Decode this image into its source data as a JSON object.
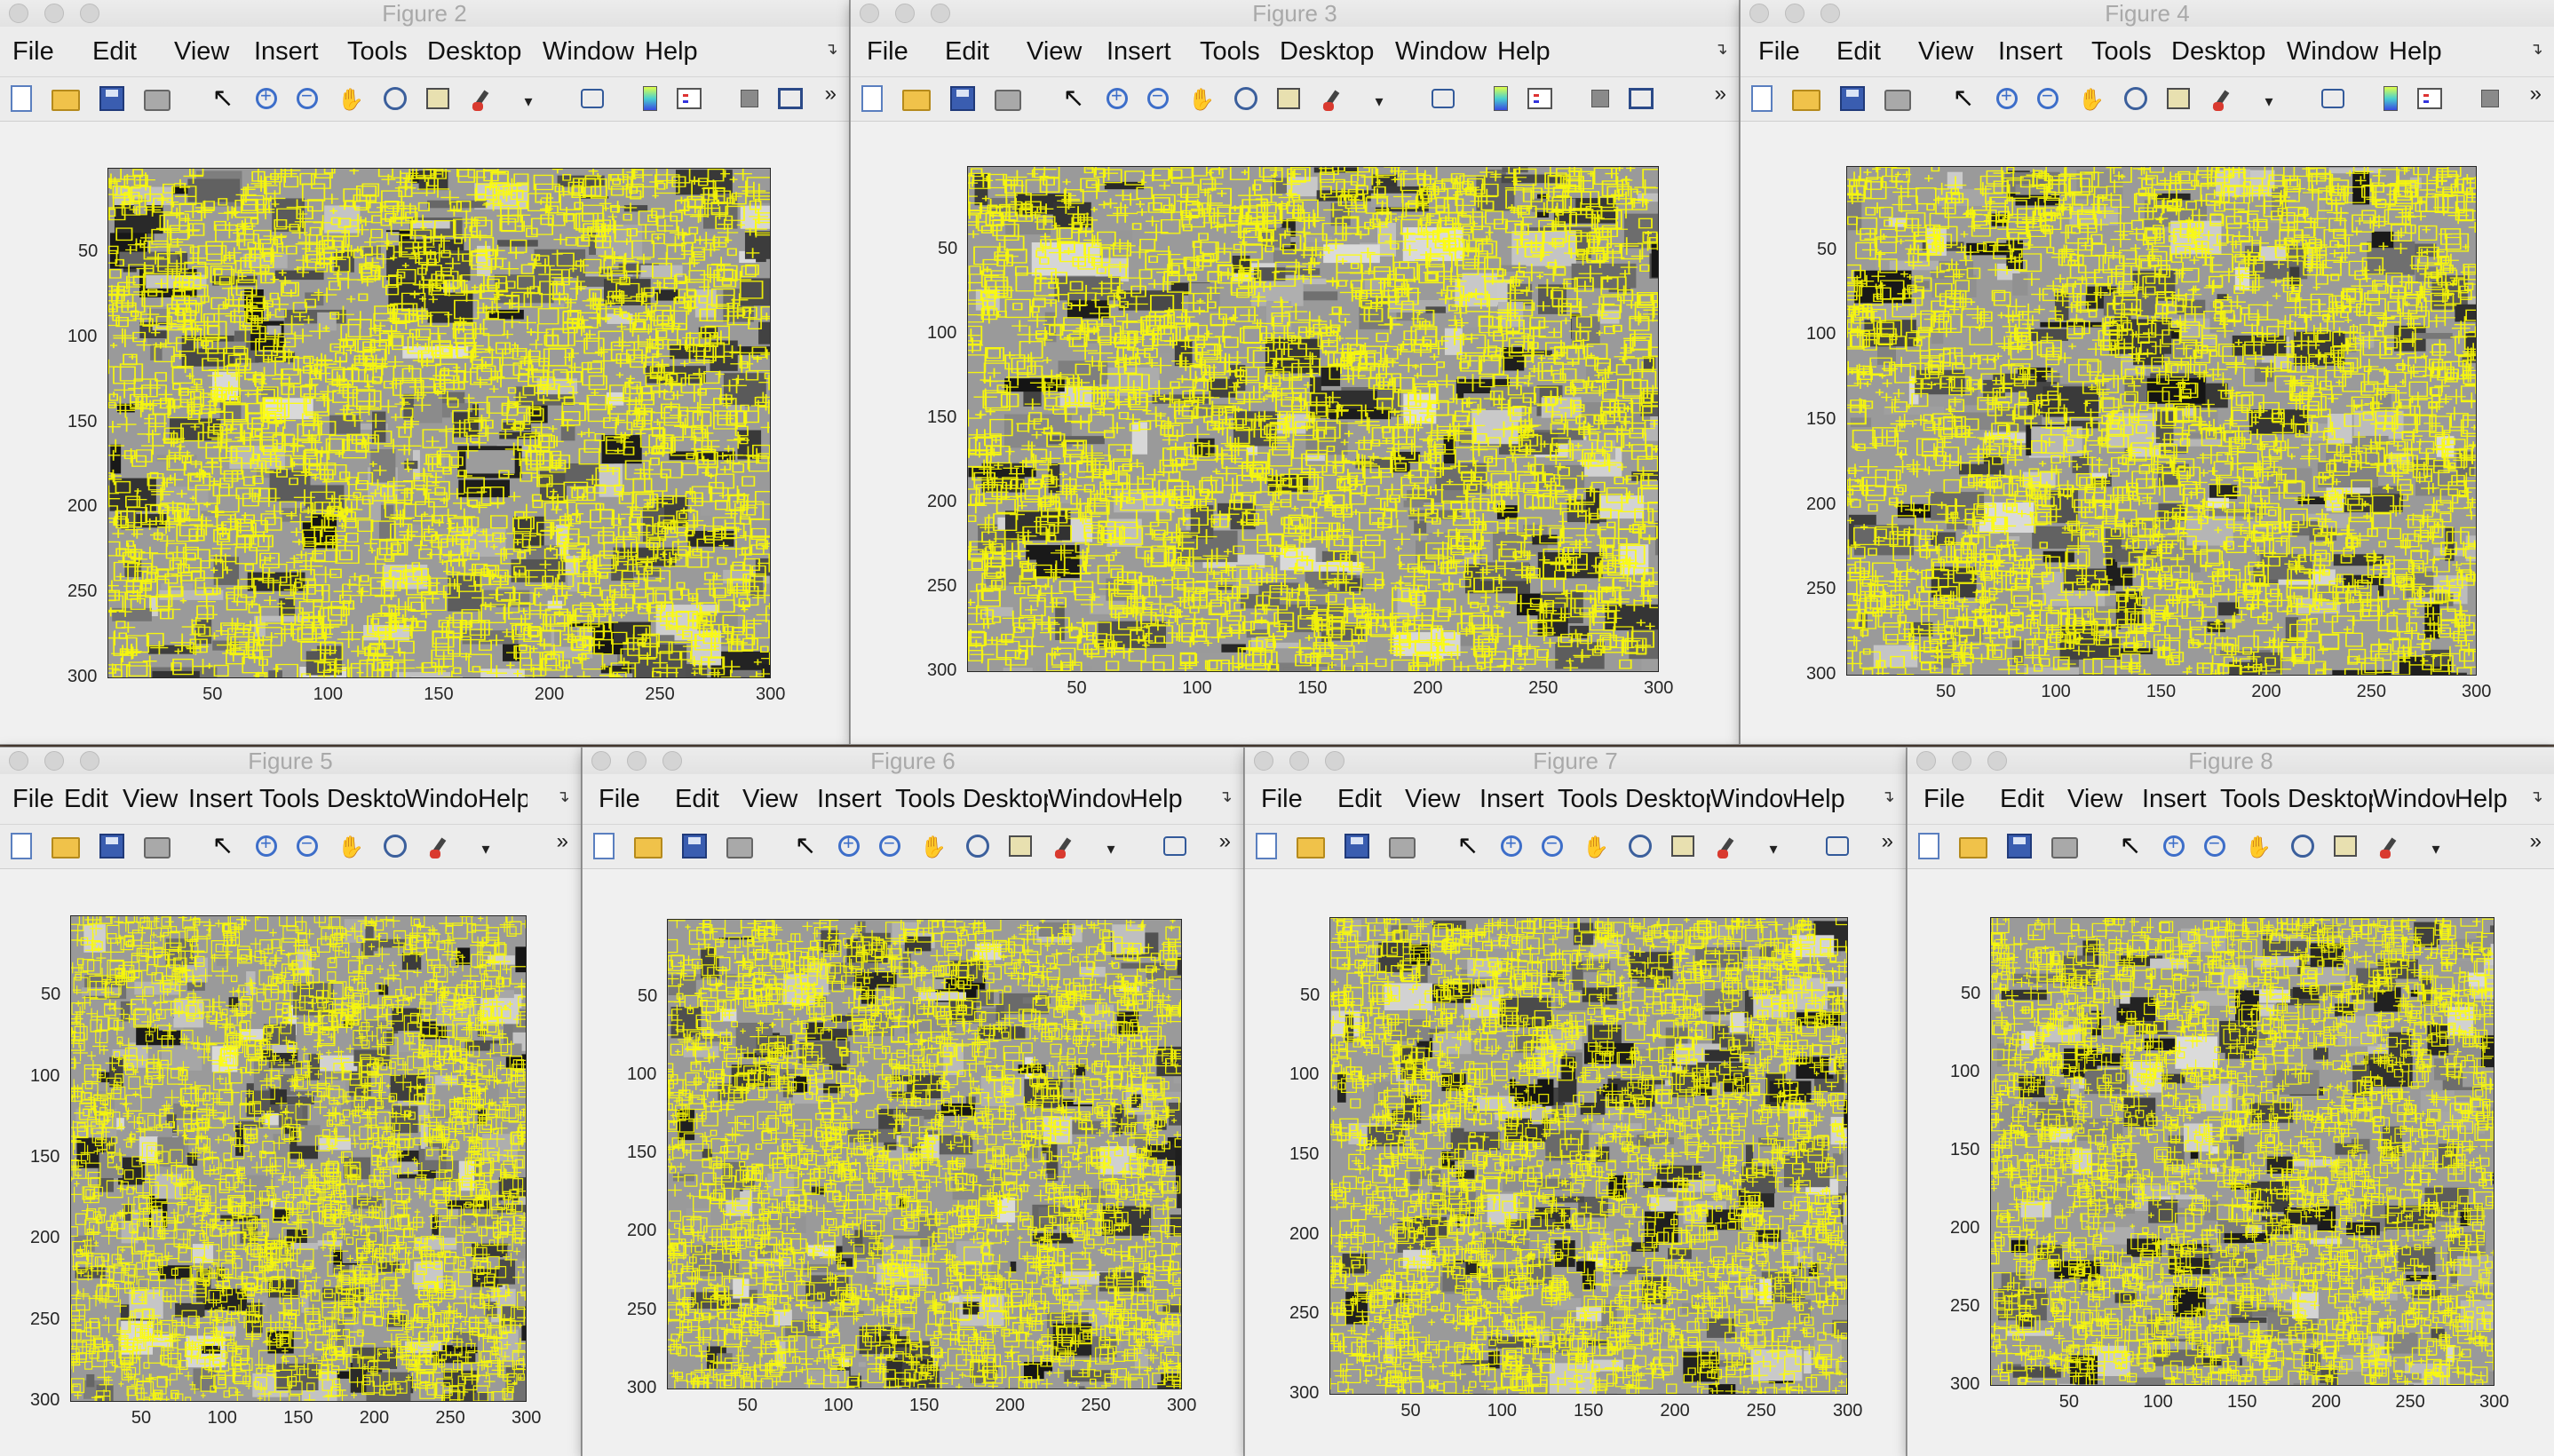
{
  "figures": [
    {
      "title": "Figure 2",
      "menus": [
        "File",
        "Edit",
        "View",
        "Insert",
        "Tools",
        "Desktop",
        "Window",
        "Help"
      ],
      "toolbar_icons": [
        "new-figure-icon",
        "open-file-icon",
        "save-icon",
        "print-icon",
        "sep",
        "pointer-arrow-icon",
        "zoom-in-icon",
        "zoom-out-icon",
        "pan-hand-icon",
        "rotate-3d-icon",
        "data-cursor-icon",
        "brush-icon",
        "dropdown-icon",
        "sep",
        "link-plot-icon",
        "sep",
        "colorbar-icon",
        "legend-icon",
        "sep",
        "hide-plot-tools-icon",
        "show-plot-tools-icon"
      ],
      "x_ticks": [
        "50",
        "100",
        "150",
        "200",
        "250",
        "300"
      ],
      "y_ticks": [
        "50",
        "100",
        "150",
        "200",
        "250",
        "300"
      ],
      "x_lim": [
        1,
        300
      ],
      "y_lim": [
        1,
        300
      ]
    },
    {
      "title": "Figure 3",
      "menus": [
        "File",
        "Edit",
        "View",
        "Insert",
        "Tools",
        "Desktop",
        "Window",
        "Help"
      ],
      "toolbar_icons": [
        "new-figure-icon",
        "open-file-icon",
        "save-icon",
        "print-icon",
        "sep",
        "pointer-arrow-icon",
        "zoom-in-icon",
        "zoom-out-icon",
        "pan-hand-icon",
        "rotate-3d-icon",
        "data-cursor-icon",
        "brush-icon",
        "dropdown-icon",
        "sep",
        "link-plot-icon",
        "sep",
        "colorbar-icon",
        "legend-icon",
        "sep",
        "hide-plot-tools-icon",
        "show-plot-tools-icon"
      ],
      "x_ticks": [
        "50",
        "100",
        "150",
        "200",
        "250",
        "300"
      ],
      "y_ticks": [
        "50",
        "100",
        "150",
        "200",
        "250",
        "300"
      ],
      "x_lim": [
        1,
        300
      ],
      "y_lim": [
        1,
        300
      ]
    },
    {
      "title": "Figure 4",
      "menus": [
        "File",
        "Edit",
        "View",
        "Insert",
        "Tools",
        "Desktop",
        "Window",
        "Help"
      ],
      "toolbar_icons": [
        "new-figure-icon",
        "open-file-icon",
        "save-icon",
        "print-icon",
        "sep",
        "pointer-arrow-icon",
        "zoom-in-icon",
        "zoom-out-icon",
        "pan-hand-icon",
        "rotate-3d-icon",
        "data-cursor-icon",
        "brush-icon",
        "dropdown-icon",
        "sep",
        "link-plot-icon",
        "sep",
        "colorbar-icon",
        "legend-icon",
        "sep",
        "hide-plot-tools-icon"
      ],
      "x_ticks": [
        "50",
        "100",
        "150",
        "200",
        "250",
        "300"
      ],
      "y_ticks": [
        "50",
        "100",
        "150",
        "200",
        "250",
        "300"
      ],
      "x_lim": [
        1,
        300
      ],
      "y_lim": [
        1,
        300
      ]
    },
    {
      "title": "Figure 5",
      "menus": [
        "File",
        "Edit",
        "View",
        "Insert",
        "Tools",
        "Desktop",
        "Window",
        "Help"
      ],
      "toolbar_icons": [
        "new-figure-icon",
        "open-file-icon",
        "save-icon",
        "print-icon",
        "sep",
        "pointer-arrow-icon",
        "zoom-in-icon",
        "zoom-out-icon",
        "pan-hand-icon",
        "rotate-3d-icon",
        "brush-icon",
        "dropdown-icon"
      ],
      "x_ticks": [
        "50",
        "100",
        "150",
        "200",
        "250",
        "300"
      ],
      "y_ticks": [
        "50",
        "100",
        "150",
        "200",
        "250",
        "300"
      ],
      "x_lim": [
        1,
        300
      ],
      "y_lim": [
        1,
        300
      ]
    },
    {
      "title": "Figure 6",
      "menus": [
        "File",
        "Edit",
        "View",
        "Insert",
        "Tools",
        "Desktop",
        "Window",
        "Help"
      ],
      "toolbar_icons": [
        "new-figure-icon",
        "open-file-icon",
        "save-icon",
        "print-icon",
        "sep",
        "pointer-arrow-icon",
        "zoom-in-icon",
        "zoom-out-icon",
        "pan-hand-icon",
        "rotate-3d-icon",
        "data-cursor-icon",
        "brush-icon",
        "dropdown-icon",
        "sep",
        "link-plot-icon"
      ],
      "x_ticks": [
        "50",
        "100",
        "150",
        "200",
        "250",
        "300"
      ],
      "y_ticks": [
        "50",
        "100",
        "150",
        "200",
        "250",
        "300"
      ],
      "x_lim": [
        1,
        300
      ],
      "y_lim": [
        1,
        300
      ]
    },
    {
      "title": "Figure 7",
      "menus": [
        "File",
        "Edit",
        "View",
        "Insert",
        "Tools",
        "Desktop",
        "Window",
        "Help"
      ],
      "toolbar_icons": [
        "new-figure-icon",
        "open-file-icon",
        "save-icon",
        "print-icon",
        "sep",
        "pointer-arrow-icon",
        "zoom-in-icon",
        "zoom-out-icon",
        "pan-hand-icon",
        "rotate-3d-icon",
        "data-cursor-icon",
        "brush-icon",
        "dropdown-icon",
        "sep",
        "link-plot-icon"
      ],
      "x_ticks": [
        "50",
        "100",
        "150",
        "200",
        "250",
        "300"
      ],
      "y_ticks": [
        "50",
        "100",
        "150",
        "200",
        "250",
        "300"
      ],
      "x_lim": [
        1,
        300
      ],
      "y_lim": [
        1,
        300
      ]
    },
    {
      "title": "Figure 8",
      "menus": [
        "File",
        "Edit",
        "View",
        "Insert",
        "Tools",
        "Desktop",
        "Window",
        "Help"
      ],
      "toolbar_icons": [
        "new-figure-icon",
        "open-file-icon",
        "save-icon",
        "print-icon",
        "sep",
        "pointer-arrow-icon",
        "zoom-in-icon",
        "zoom-out-icon",
        "pan-hand-icon",
        "rotate-3d-icon",
        "data-cursor-icon",
        "brush-icon",
        "dropdown-icon"
      ],
      "x_ticks": [
        "50",
        "100",
        "150",
        "200",
        "250",
        "300"
      ],
      "y_ticks": [
        "50",
        "100",
        "150",
        "200",
        "250",
        "300"
      ],
      "x_lim": [
        1,
        300
      ],
      "y_lim": [
        1,
        300
      ]
    }
  ],
  "colors": {
    "feature_markers": "#ffff00",
    "image_dark": "#1a1a1a",
    "image_light": "#b9b9b9",
    "window_bg": "#ececec",
    "desktop_bg": "#5b4a3e"
  }
}
